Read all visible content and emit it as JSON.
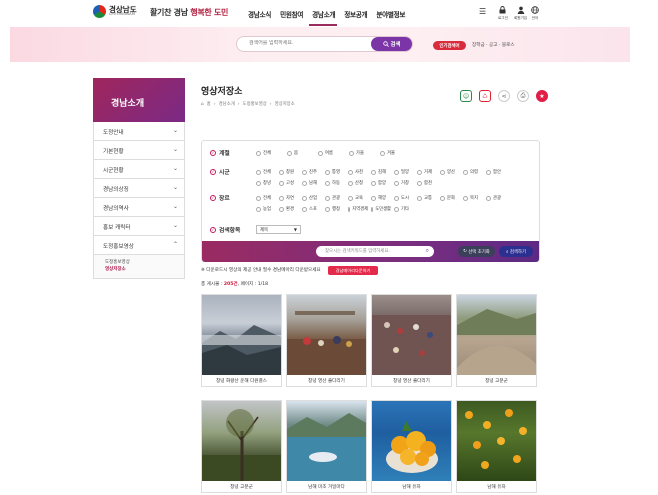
{
  "header": {
    "logo_kr": "경상남도",
    "logo_en": "GYEONGNAM",
    "slogan_plain": "활기찬 경남",
    "slogan_accent": "행복한 도민",
    "nav": [
      "경남소식",
      "민원참여",
      "경남소개",
      "정보공개",
      "분야별정보"
    ],
    "utilities": [
      {
        "icon": "lock-icon",
        "label": "로그인"
      },
      {
        "icon": "user-icon",
        "label": "회원가입"
      },
      {
        "icon": "globe-icon",
        "label": "언어"
      }
    ]
  },
  "search": {
    "placeholder": "검색어를 입력하세요.",
    "button_label": "검색",
    "hot_badge": "인기검색어",
    "hot_keywords": "장학금 · 공고 · 블로스"
  },
  "lnb": {
    "title": "경남소개",
    "items": [
      "도정안내",
      "기본현황",
      "시군현황",
      "경남의상징",
      "경남의역사",
      "홍보 캐릭터",
      "도정홍보영상"
    ],
    "sub_items": [
      "도정홍보영상",
      "영상저장소"
    ]
  },
  "content": {
    "title": "영상저장소",
    "breadcrumb": [
      "홈",
      "경남소개",
      "도정홍보영상",
      "영상저장소"
    ]
  },
  "filter": {
    "season": {
      "label": "계절",
      "options": [
        "전체",
        "봄",
        "여름",
        "가을",
        "겨울"
      ]
    },
    "region": {
      "label": "시군",
      "options": [
        "전체",
        "창원",
        "진주",
        "통영",
        "사천",
        "김해",
        "밀양",
        "거제",
        "양산",
        "의령",
        "함안",
        "창녕",
        "고성",
        "남해",
        "하동",
        "산청",
        "함양",
        "거창",
        "합천"
      ]
    },
    "theme": {
      "label": "장르",
      "options": [
        "전체",
        "자연",
        "산업",
        "관광",
        "교육",
        "해양",
        "도시",
        "교통",
        "문화",
        "복지",
        "관광",
        "농업",
        "환경",
        "스포",
        "행정",
        "지역경제",
        "도민생활",
        "기타"
      ]
    },
    "search_field": {
      "label": "검색항목",
      "value": "제목"
    },
    "keyword_placeholder": "찾으시는 검색키워드를 입력하세요.",
    "reset_label": "선택 초기화",
    "search_label": "검색하기"
  },
  "notice": {
    "text": "※ 다운로드시 영상의 제공 안내 필수 경남메아리 다운받으세요",
    "button": "경남메아리다운하기"
  },
  "count": {
    "prefix": "총 게시물 : ",
    "total": "205건",
    "suffix": ", 페이지 : 1/18"
  },
  "videos": [
    {
      "title": "창녕 화왕산 운해 다원결스",
      "tone": "v0"
    },
    {
      "title": "창녕 영산 줄다리기",
      "tone": "v1"
    },
    {
      "title": "창녕 영산 줄다리기",
      "tone": "v2"
    },
    {
      "title": "창녕 고분군",
      "tone": "v3"
    },
    {
      "title": "창녕 고분군",
      "tone": "v4"
    },
    {
      "title": "남해 미조 거일마다",
      "tone": "v5"
    },
    {
      "title": "남해 유자",
      "tone": "v6"
    },
    {
      "title": "남해 유자",
      "tone": "v7"
    }
  ]
}
